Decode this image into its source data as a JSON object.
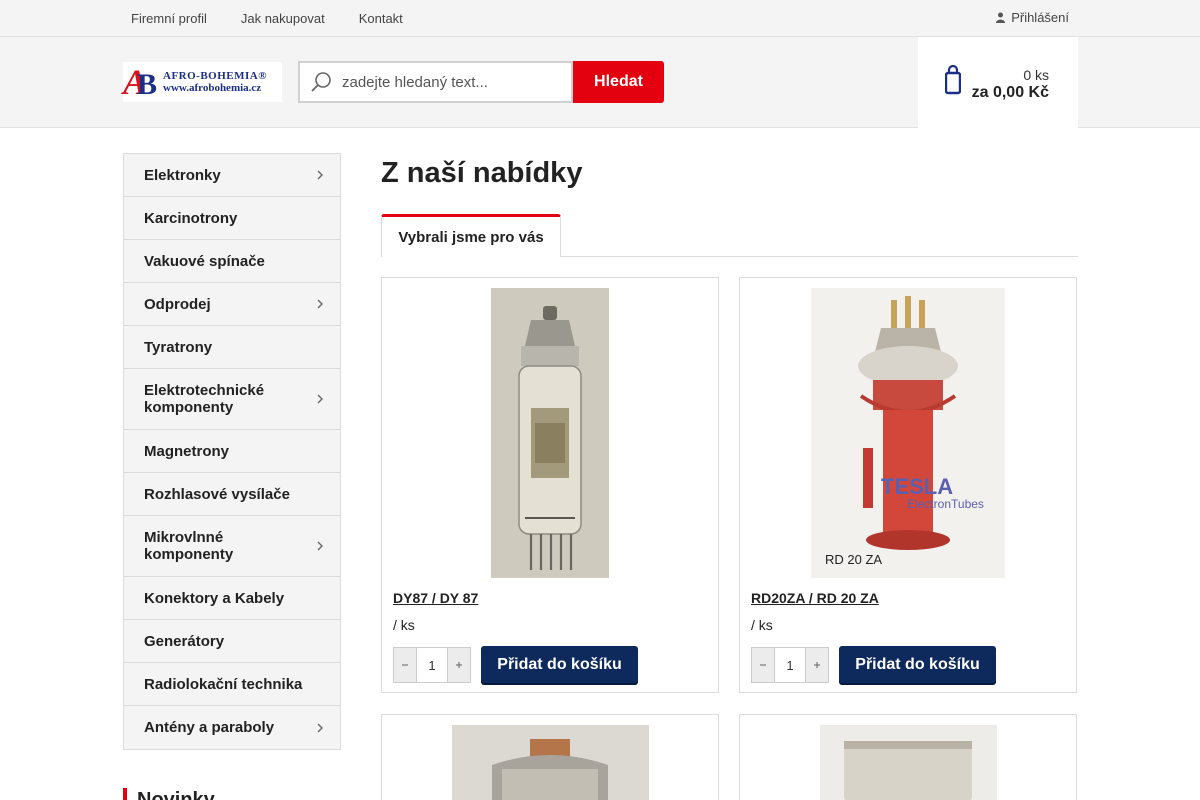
{
  "topnav": {
    "links": [
      "Firemní profil",
      "Jak nakupovat",
      "Kontakt"
    ],
    "login_label": "Přihlášení"
  },
  "logo": {
    "mark_a": "A",
    "mark_b": "B",
    "name": "AFRO-BOHEMIA®",
    "url": "www.afrobohemia.cz"
  },
  "search": {
    "placeholder": "zadejte hledaný text...",
    "button_label": "Hledat"
  },
  "cart": {
    "qty": "0 ks",
    "price": "za 0,00 Kč"
  },
  "sidebar": {
    "categories": [
      {
        "label": "Elektronky",
        "has_submenu": true
      },
      {
        "label": "Karcinotrony",
        "has_submenu": false
      },
      {
        "label": "Vakuové spínače",
        "has_submenu": false
      },
      {
        "label": "Odprodej",
        "has_submenu": true
      },
      {
        "label": "Tyratrony",
        "has_submenu": false
      },
      {
        "label": "Elektrotechnické komponenty",
        "has_submenu": true
      },
      {
        "label": "Magnetrony",
        "has_submenu": false
      },
      {
        "label": "Rozhlasové vysílače",
        "has_submenu": false
      },
      {
        "label": "Mikrovlnné komponenty",
        "has_submenu": true
      },
      {
        "label": "Konektory a Kabely",
        "has_submenu": false
      },
      {
        "label": "Generátory",
        "has_submenu": false
      },
      {
        "label": "Radiolokační technika",
        "has_submenu": false
      },
      {
        "label": "Antény a paraboly",
        "has_submenu": true
      }
    ],
    "novinky_title": "Novinky"
  },
  "main": {
    "title": "Z naší nabídky",
    "tab_label": "Vybrali jsme pro vás",
    "products": [
      {
        "name": "DY87 / DY 87",
        "unit": "/ ks",
        "qty": "1",
        "add_label": "Přidat do košíku"
      },
      {
        "name": "RD20ZA / RD 20 ZA",
        "unit": "/ ks",
        "qty": "1",
        "add_label": "Přidat do košíku",
        "image_caption": "RD 20 ZA",
        "brand": "TESLA",
        "brand_sub": "ElectronTubes"
      }
    ]
  },
  "colors": {
    "accent_red": "#e3000f",
    "button_navy": "#0e2a5c",
    "logo_blue": "#1b2f86"
  }
}
